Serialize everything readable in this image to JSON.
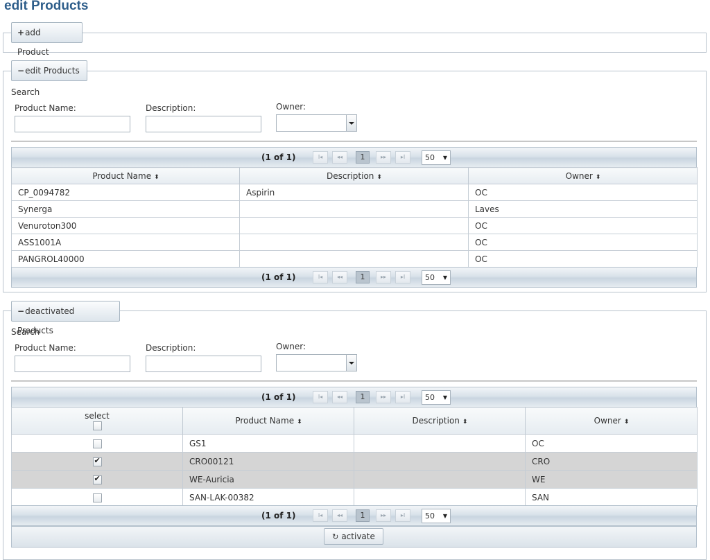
{
  "page": {
    "title": "edit Products"
  },
  "add_panel": {
    "legend_symbol": "+",
    "legend": "add Product"
  },
  "edit_panel": {
    "legend_symbol": "−",
    "legend": "edit Products",
    "search_label": "Search",
    "filters": {
      "product_name_label": "Product Name:",
      "description_label": "Description:",
      "owner_label": "Owner:",
      "product_name_value": "",
      "description_value": "",
      "owner_value": ""
    },
    "pager": {
      "count": "(1 of 1)",
      "first": "I◂",
      "prev": "◂◂",
      "page": "1",
      "next": "▸▸",
      "last": "▸I",
      "rows": "50"
    },
    "columns": [
      "Product Name",
      "Description",
      "Owner"
    ],
    "sort_icon": "⬍",
    "rows": [
      {
        "name": "CP_0094782",
        "description": "Aspirin",
        "owner": "OC"
      },
      {
        "name": "Synerga",
        "description": "",
        "owner": "Laves"
      },
      {
        "name": "Venuroton300",
        "description": "",
        "owner": "OC"
      },
      {
        "name": "ASS1001A",
        "description": "",
        "owner": "OC"
      },
      {
        "name": "PANGROL40000",
        "description": "",
        "owner": "OC"
      }
    ]
  },
  "deact_panel": {
    "legend_symbol": "−",
    "legend": "deactivated Products",
    "search_label": "Search",
    "filters": {
      "product_name_label": "Product Name:",
      "description_label": "Description:",
      "owner_label": "Owner:",
      "product_name_value": "",
      "description_value": "",
      "owner_value": ""
    },
    "pager": {
      "count": "(1 of 1)",
      "first": "I◂",
      "prev": "◂◂",
      "page": "1",
      "next": "▸▸",
      "last": "▸I",
      "rows": "50"
    },
    "select_label": "select",
    "columns": [
      "Product Name",
      "Description",
      "Owner"
    ],
    "sort_icon": "⬍",
    "rows": [
      {
        "selected": false,
        "name": "GS1",
        "description": "",
        "owner": "OC"
      },
      {
        "selected": true,
        "name": "CRO00121",
        "description": "",
        "owner": "CRO"
      },
      {
        "selected": true,
        "name": "WE-Auricia",
        "description": "",
        "owner": "WE"
      },
      {
        "selected": false,
        "name": "SAN-LAK-00382",
        "description": "",
        "owner": "SAN"
      }
    ],
    "activate_icon": "↻",
    "activate_label": "activate"
  }
}
